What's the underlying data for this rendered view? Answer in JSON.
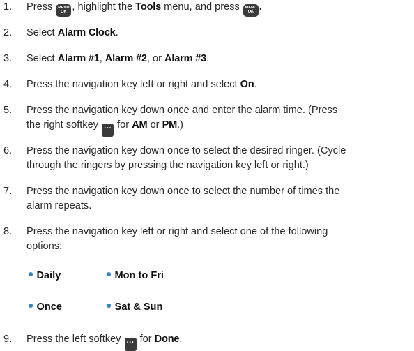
{
  "keys": {
    "menu_line1": "MENU",
    "menu_line2": "OK",
    "soft_glyph": "···"
  },
  "steps": [
    {
      "num": "1.",
      "t1": "Press ",
      "t2": ", highlight the ",
      "b1": "Tools",
      "t3": " menu, and press ",
      "b2": "."
    },
    {
      "num": "2.",
      "t1": "Select ",
      "b1": "Alarm Clock",
      "t2": "."
    },
    {
      "num": "3.",
      "t1": "Select ",
      "b1": "Alarm #1",
      "t2": ", ",
      "b2": "Alarm #2",
      "t3": ", or ",
      "b3": "Alarm #3",
      "t4": "."
    },
    {
      "num": "4.",
      "t1": "Press the navigation key left or right and select ",
      "b1": "On",
      "t2": "."
    },
    {
      "num": "5.",
      "l1": "Press the navigation key down once and enter the alarm time. (Press",
      "t1": "the right softkey ",
      "t2": " for ",
      "b1": "AM",
      "t3": " or ",
      "b2": "PM",
      "t4": ".)"
    },
    {
      "num": "6.",
      "l1": "Press the navigation key down once to select the desired ringer. (Cycle",
      "l2": "through the ringers by pressing the navigation key left or right.)"
    },
    {
      "num": "7.",
      "l1": "Press the navigation key down once to select the number of times the",
      "l2": "alarm repeats."
    },
    {
      "num": "8.",
      "l1": "Press the navigation key left or right and select one of the following",
      "l2": "options:"
    },
    {
      "num": "9.",
      "t1": "Press the left softkey ",
      "t2": " for ",
      "b1": "Done",
      "t3": "."
    }
  ],
  "options": [
    "Daily",
    "Mon to Fri",
    "Once",
    "Sat & Sun"
  ],
  "colors": {
    "bullet": "#2e86c8",
    "key": "#3a3a3a",
    "text": "#2a2a2a"
  }
}
